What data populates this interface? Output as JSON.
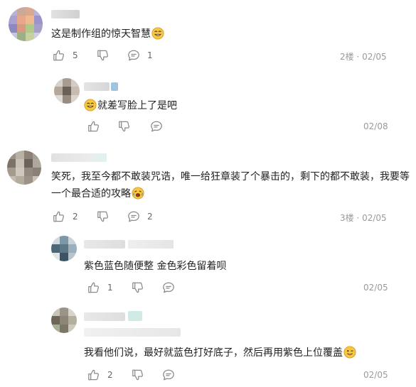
{
  "comments": [
    {
      "text": "这是制作组的惊天智慧",
      "likes": "5",
      "replies_count": "1",
      "floor": "2楼",
      "date": "02/05"
    },
    {
      "text": "就差写脸上了是吧",
      "date": "02/08"
    },
    {
      "text_line1": "笑死，我至今都不敢装咒诰，唯一给狂章装了个暴击的，剩下的都不敢装，我要等",
      "text_line2": "一个最合适的攻略",
      "likes": "2",
      "replies_count": "2",
      "floor": "3楼",
      "date": "02/05"
    },
    {
      "text": "紫色蓝色随便整   金色彩色留着呗",
      "likes": "1",
      "date": "02/05"
    },
    {
      "text": "我看他们说，最好就蓝色打好底子，然后再用紫色上位覆盖",
      "likes": "2",
      "date": "02/05"
    }
  ],
  "colors": {
    "icon": "#8a8a8a",
    "meta": "#9a9a9a",
    "text": "#222222",
    "emoji": "#f5c842"
  },
  "icons": [
    "thumb-up-icon",
    "thumb-down-icon",
    "reply-bubble-icon",
    "smile-emoji-icon",
    "laughing-emoji-icon",
    "cry-laugh-emoji-icon",
    "wink-tongue-emoji-icon"
  ]
}
